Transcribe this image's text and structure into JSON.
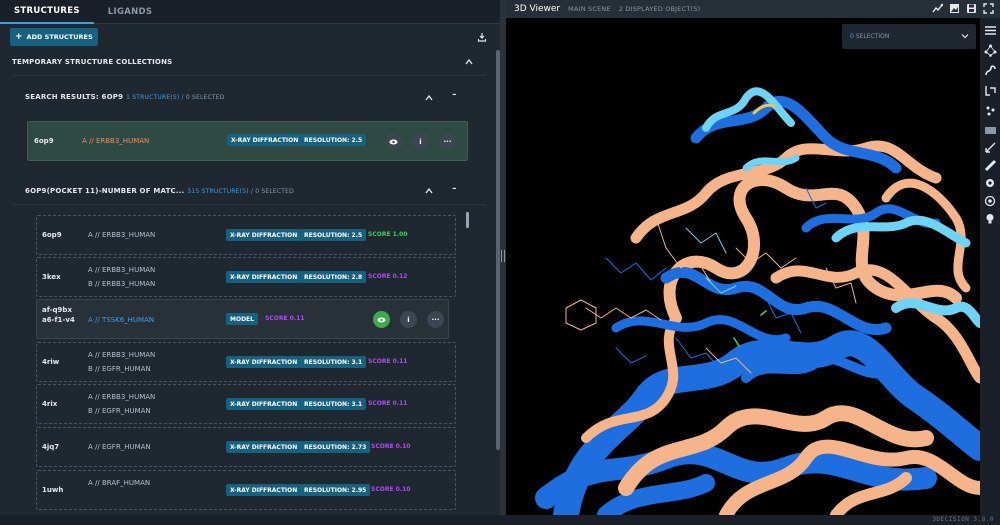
{
  "tabs": [
    {
      "label": "STRUCTURES",
      "active": true
    },
    {
      "label": "LIGANDS",
      "active": false
    }
  ],
  "toolbar": {
    "add_label": "ADD STRUCTURES"
  },
  "temp_collections": {
    "title": "TEMPORARY STRUCTURE COLLECTIONS"
  },
  "search_section": {
    "title": "SEARCH RESULTS: 6OP9",
    "count": "1 STRUCTURE(S)",
    "selected": "0 SELECTED",
    "item": {
      "pdb": "6op9",
      "chain": "A // ERBB3_HUMAN",
      "method": "X-RAY DIFFRACTION",
      "resolution": "RESOLUTION: 2.5"
    }
  },
  "pocket_section": {
    "title": "6OP9(POCKET 11)-NUMBER OF MATC...",
    "count": "515 STRUCTURE(S)",
    "selected": "0 SELECTED",
    "items": [
      {
        "pdb": "6op9",
        "chains": [
          "A // ERBB3_HUMAN"
        ],
        "method": "X-RAY DIFFRACTION",
        "resolution": "RESOLUTION: 2.5",
        "score": "SCORE 1.00",
        "score_color": "green"
      },
      {
        "pdb": "3kex",
        "chains": [
          "A // ERBB3_HUMAN",
          "B // ERBB3_HUMAN"
        ],
        "method": "X-RAY DIFFRACTION",
        "resolution": "RESOLUTION: 2.8",
        "score": "SCORE 0.12",
        "score_color": "purple"
      },
      {
        "pdb": "af-q9bxa6-f1-v4",
        "chains": [
          "A // TSSK6_HUMAN"
        ],
        "method": "MODEL",
        "resolution": "",
        "score": "SCORE 0.11",
        "score_color": "purple"
      },
      {
        "pdb": "4riw",
        "chains": [
          "A // ERBB3_HUMAN",
          "B // EGFR_HUMAN"
        ],
        "method": "X-RAY DIFFRACTION",
        "resolution": "RESOLUTION: 3.1",
        "score": "SCORE 0.11",
        "score_color": "purple"
      },
      {
        "pdb": "4rix",
        "chains": [
          "A // ERBB3_HUMAN",
          "B // EGFR_HUMAN"
        ],
        "method": "X-RAY DIFFRACTION",
        "resolution": "RESOLUTION: 3.1",
        "score": "SCORE 0.11",
        "score_color": "purple"
      },
      {
        "pdb": "4jq7",
        "chains": [
          "A // EGFR_HUMAN"
        ],
        "method": "X-RAY DIFFRACTION",
        "resolution": "RESOLUTION: 2.73",
        "score": "SCORE 0.10",
        "score_color": "purple"
      },
      {
        "pdb": "1uwh",
        "chains": [
          "A // BRAF_HUMAN"
        ],
        "method": "X-RAY DIFFRACTION",
        "resolution": "RESOLUTION: 2.95",
        "score": "SCORE 0.10",
        "score_color": "purple"
      }
    ]
  },
  "viewer": {
    "title": "3D Viewer",
    "scene": "MAIN SCENE",
    "objects": "2 DISPLAYED OBJECT(S)",
    "selection_count": "0",
    "selection_label": "SELECTION"
  },
  "colors": {
    "accent": "#3aa0e6",
    "badge": "#16617f",
    "protein_a": "#f5b48a",
    "protein_b": "#1e6ee0",
    "protein_c": "#6fd3f5"
  },
  "version": "3DECISION 3.8.0"
}
